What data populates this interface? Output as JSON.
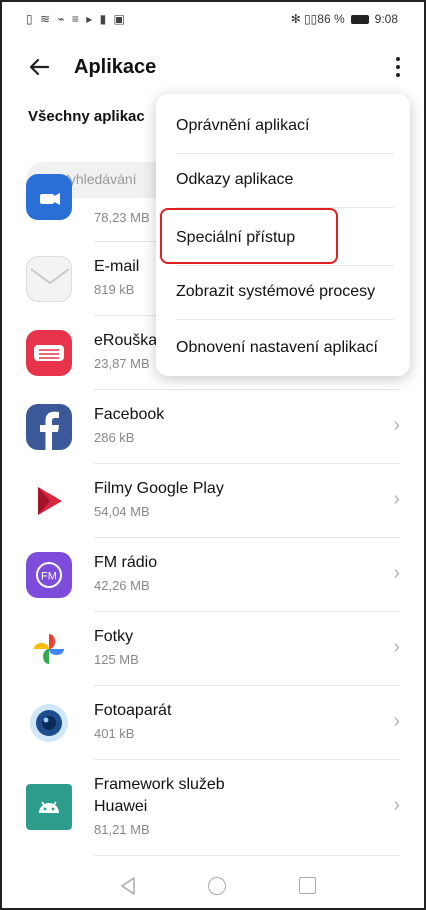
{
  "status_bar": {
    "left_icons": "▯ ≋ ⌁ ≡ ▸ ▮ ▣",
    "right_text": "✻ ▯▯86 %",
    "time": "9:08"
  },
  "appbar": {
    "title": "Aplikace"
  },
  "section_title": "Všechny aplikac",
  "search": {
    "placeholder": "Vyhledávání"
  },
  "apps": [
    {
      "name": "",
      "size": "78,23 MB"
    },
    {
      "name": "E-mail",
      "size": "819 kB"
    },
    {
      "name": "eRouška",
      "size": "23,87 MB"
    },
    {
      "name": "Facebook",
      "size": "286 kB"
    },
    {
      "name": "Filmy Google Play",
      "size": "54,04 MB"
    },
    {
      "name": "FM rádio",
      "size": "42,26 MB"
    },
    {
      "name": "Fotky",
      "size": "125 MB"
    },
    {
      "name": "Fotoaparát",
      "size": "401 kB"
    },
    {
      "name_line1": "Framework služeb",
      "name_line2": "Huawei",
      "size": "81,21 MB"
    }
  ],
  "menu": {
    "items": [
      "Oprávnění aplikací",
      "Odkazy aplikace",
      "Speciální přístup",
      "Zobrazit systémové procesy",
      "Obnovení nastavení aplikací"
    ]
  },
  "colors": {
    "highlight": "#e02020",
    "facebook": "#3b5998",
    "fm": "#7d4cdb",
    "erouska": "#e8344a"
  }
}
